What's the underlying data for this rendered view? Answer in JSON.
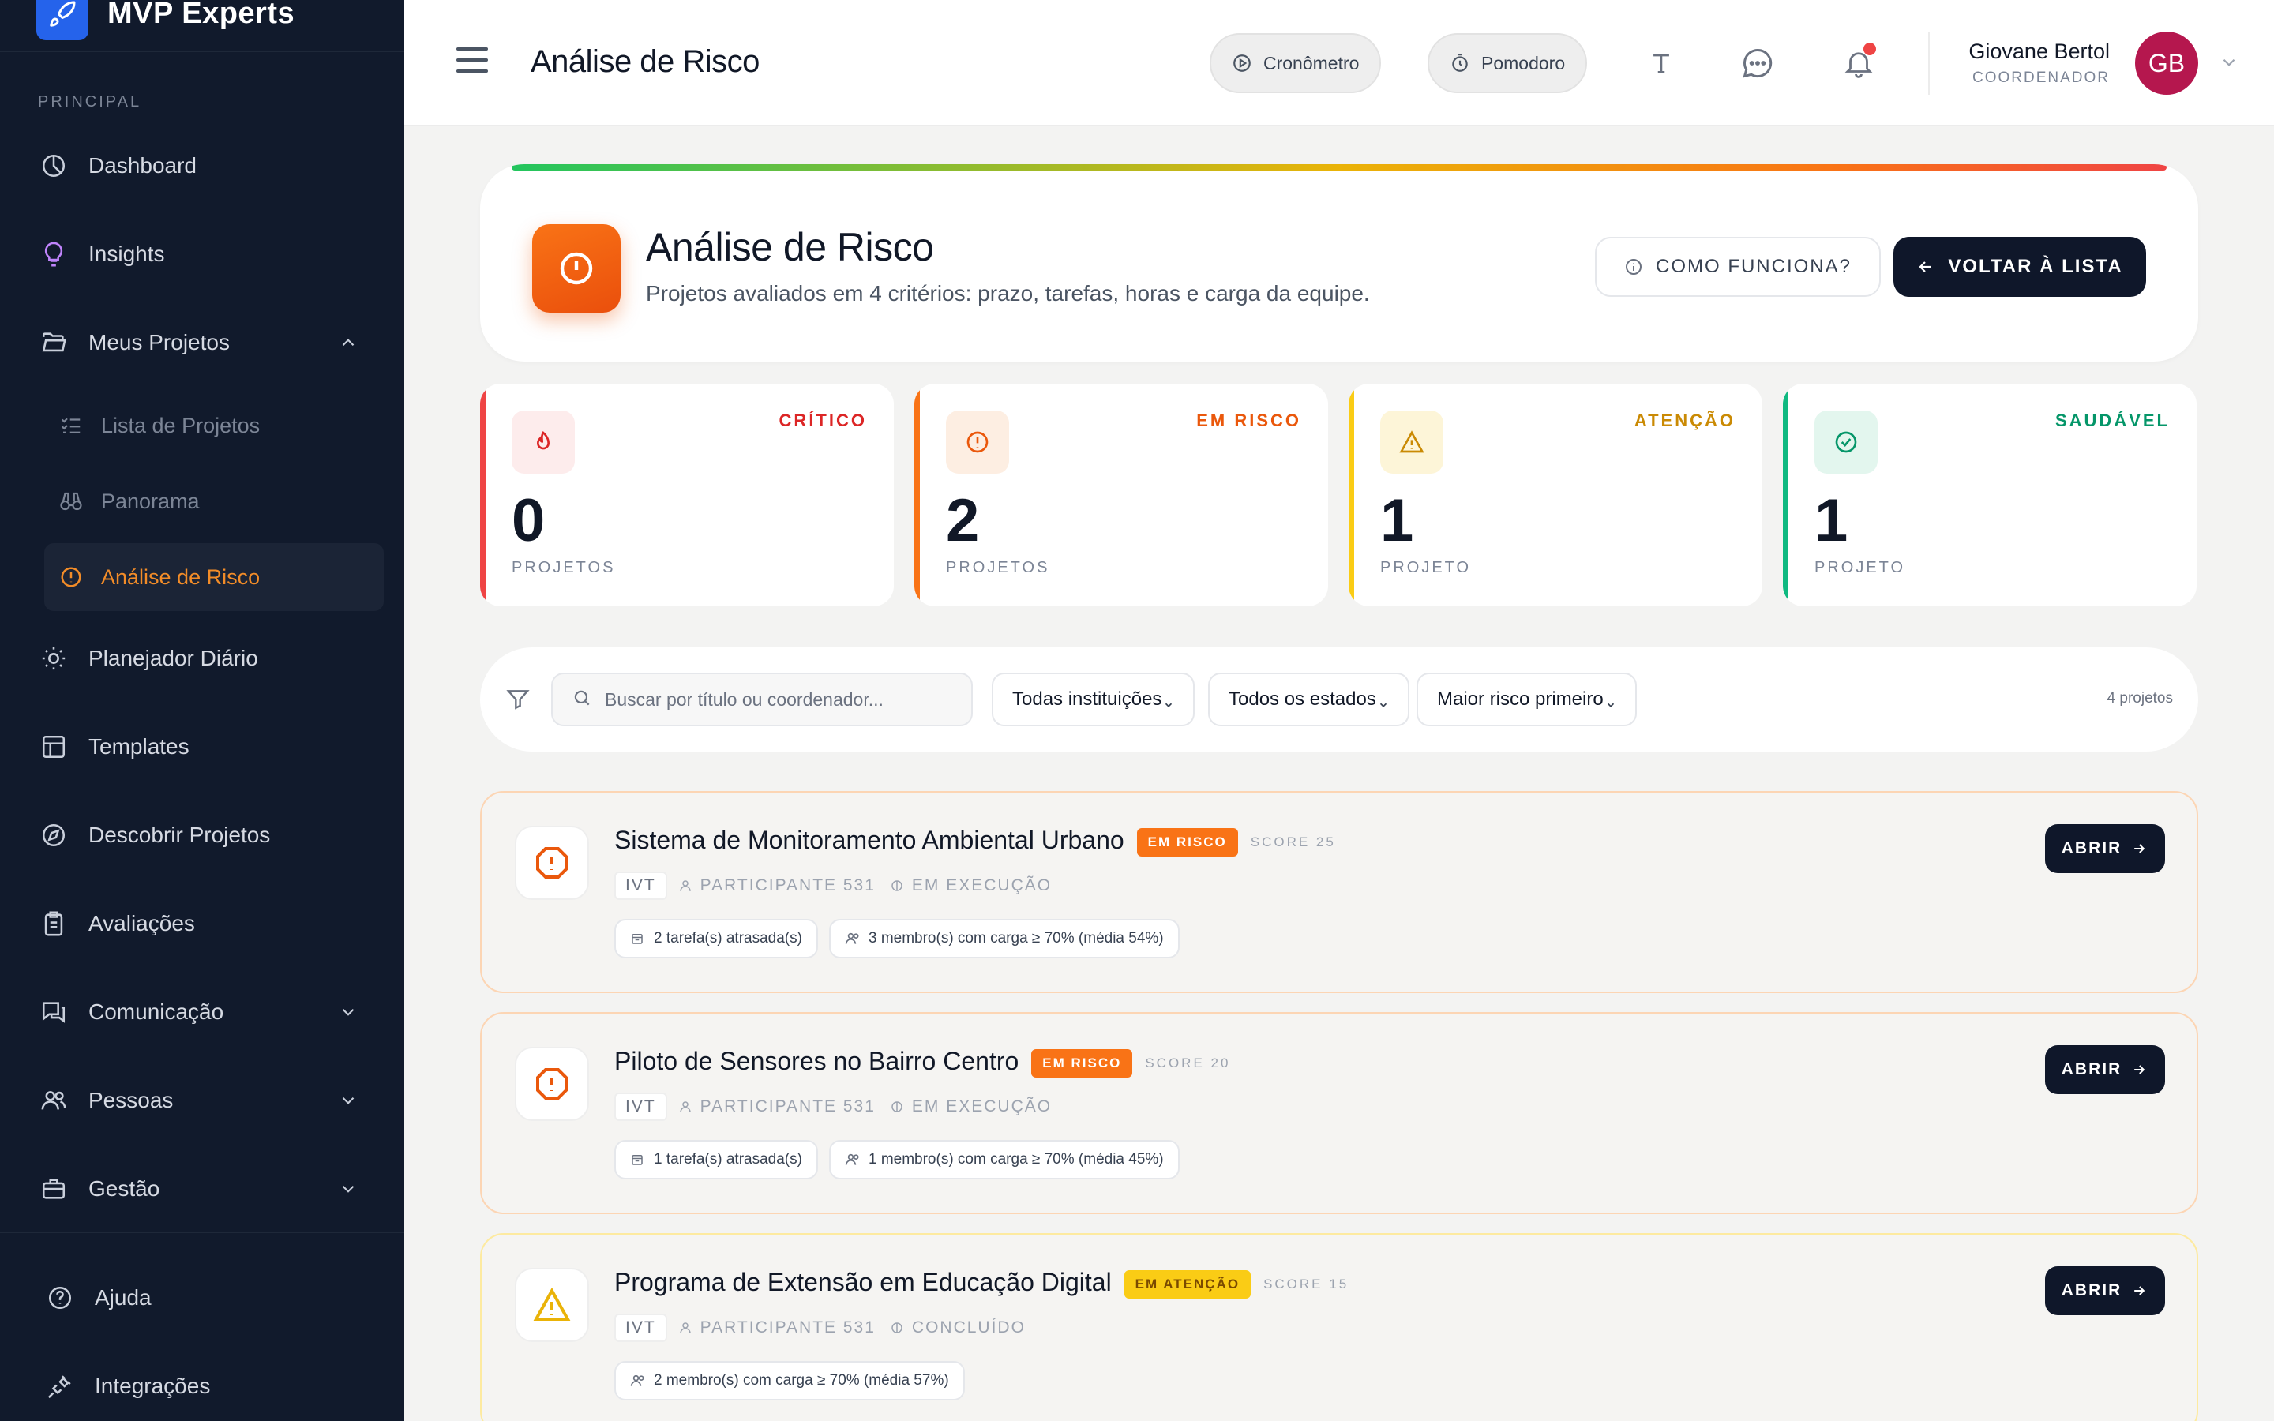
{
  "brand": {
    "name": "MVP Experts"
  },
  "sidebar": {
    "section_label": "PRINCIPAL",
    "items": [
      {
        "label": "Dashboard"
      },
      {
        "label": "Insights"
      },
      {
        "label": "Meus Projetos"
      },
      {
        "label": "Planejador Diário"
      },
      {
        "label": "Templates"
      },
      {
        "label": "Descobrir Projetos"
      },
      {
        "label": "Avaliações"
      },
      {
        "label": "Comunicação"
      },
      {
        "label": "Pessoas"
      },
      {
        "label": "Gestão"
      }
    ],
    "subitems": [
      {
        "label": "Lista de Projetos"
      },
      {
        "label": "Panorama"
      },
      {
        "label": "Análise de Risco"
      }
    ],
    "footer": [
      {
        "label": "Ajuda"
      },
      {
        "label": "Integrações"
      }
    ]
  },
  "header": {
    "title": "Análise de Risco",
    "cronometro_label": "Cronômetro",
    "pomodoro_label": "Pomodoro",
    "user_name": "Giovane Bertol",
    "user_role": "COORDENADOR",
    "user_initials": "GB"
  },
  "hero": {
    "title": "Análise de Risco",
    "subtitle": "Projetos avaliados em 4 critérios: prazo, tarefas, horas e carga da equipe.",
    "how_label": "COMO FUNCIONA?",
    "back_label": "VOLTAR À LISTA"
  },
  "stats": [
    {
      "label": "CRÍTICO",
      "value": "0",
      "unit": "PROJETOS",
      "color": "#dc2626"
    },
    {
      "label": "EM RISCO",
      "value": "2",
      "unit": "PROJETOS",
      "color": "#ea580c"
    },
    {
      "label": "ATENÇÃO",
      "value": "1",
      "unit": "PROJETO",
      "color": "#ca8a04"
    },
    {
      "label": "SAUDÁVEL",
      "value": "1",
      "unit": "PROJETO",
      "color": "#059669"
    }
  ],
  "filters": {
    "search_placeholder": "Buscar por título ou coordenador...",
    "institution": "Todas instituições",
    "state": "Todos os estados",
    "sort": "Maior risco primeiro",
    "count": "4 projetos"
  },
  "projects": [
    {
      "title": "Sistema de Monitoramento Ambiental Urbano",
      "badge": "EM RISCO",
      "score": "SCORE 25",
      "institution": "IVT",
      "participant": "PARTICIPANTE 531",
      "status": "EM EXECUÇÃO",
      "chips": [
        "2 tarefa(s) atrasada(s)",
        "3 membro(s) com carga ≥ 70% (média 54%)"
      ],
      "open_label": "ABRIR"
    },
    {
      "title": "Piloto de Sensores no Bairro Centro",
      "badge": "EM RISCO",
      "score": "SCORE 20",
      "institution": "IVT",
      "participant": "PARTICIPANTE 531",
      "status": "EM EXECUÇÃO",
      "chips": [
        "1 tarefa(s) atrasada(s)",
        "1 membro(s) com carga ≥ 70% (média 45%)"
      ],
      "open_label": "ABRIR"
    },
    {
      "title": "Programa de Extensão em Educação Digital",
      "badge": "EM ATENÇÃO",
      "score": "SCORE 15",
      "institution": "IVT",
      "participant": "PARTICIPANTE 531",
      "status": "CONCLUÍDO",
      "chips": [
        "2 membro(s) com carga ≥ 70% (média 57%)"
      ],
      "open_label": "ABRIR"
    }
  ]
}
